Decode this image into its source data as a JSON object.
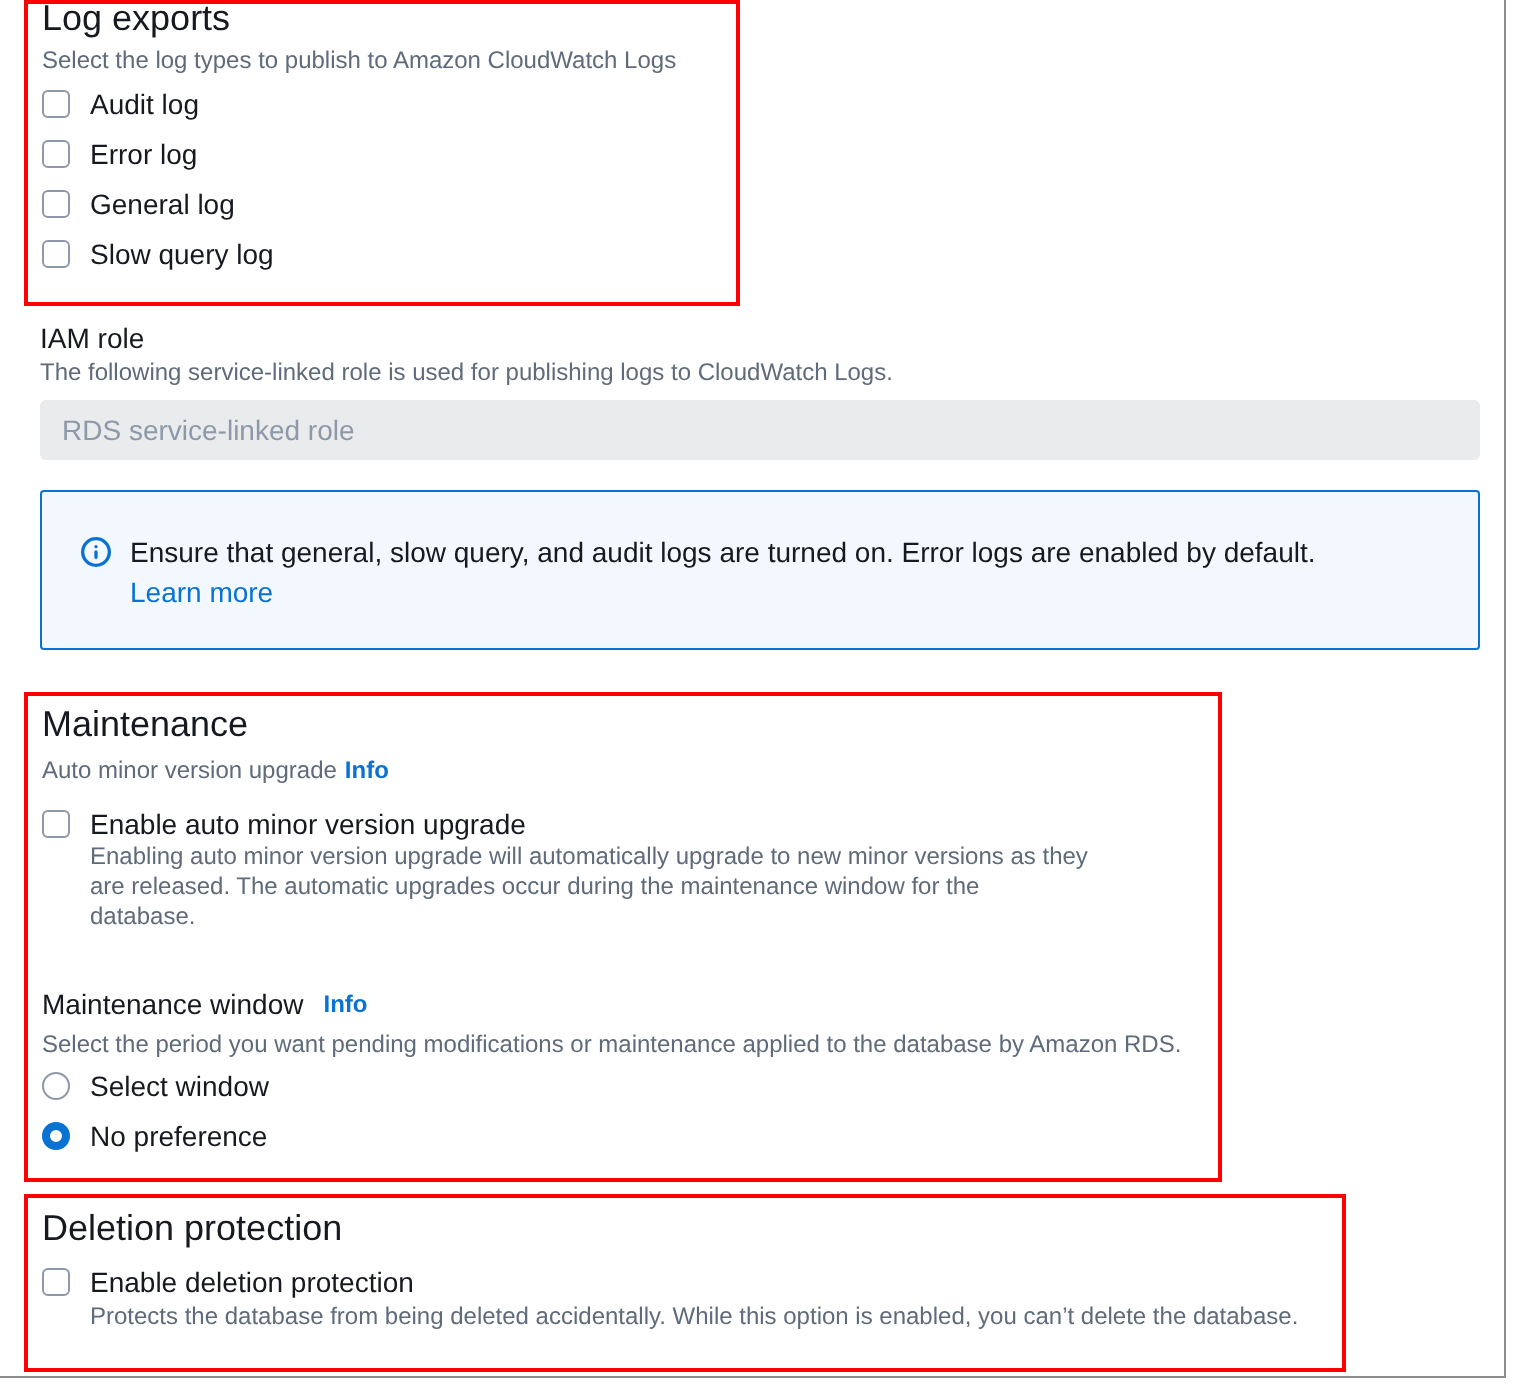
{
  "log_exports": {
    "title": "Log exports",
    "highlighted": true,
    "description": "Select the log types to publish to Amazon CloudWatch Logs",
    "options": [
      {
        "label": "Audit log",
        "checked": false
      },
      {
        "label": "Error log",
        "checked": false
      },
      {
        "label": "General log",
        "checked": false
      },
      {
        "label": "Slow query log",
        "checked": false
      }
    ]
  },
  "iam_role": {
    "label": "IAM role",
    "description": "The following service-linked role is used for publishing logs to CloudWatch Logs.",
    "value": "RDS service-linked role",
    "disabled": true
  },
  "alert": {
    "text": "Ensure that general, slow query, and audit logs are turned on. Error logs are enabled by default.",
    "link": "Learn more"
  },
  "maintenance": {
    "title": "Maintenance",
    "highlighted": true,
    "subtitle": "Auto minor version upgrade",
    "subtitle_info": "Info",
    "checkbox": {
      "label": "Enable auto minor version upgrade",
      "description": "Enabling auto minor version upgrade will automatically upgrade to new minor versions as they are released. The automatic upgrades occur during the maintenance window for the database.",
      "checked": false
    },
    "window": {
      "label": "Maintenance window",
      "info": "Info",
      "description": "Select the period you want pending modifications or maintenance applied to the database by Amazon RDS.",
      "options": [
        {
          "label": "Select window",
          "selected": false
        },
        {
          "label": "No preference",
          "selected": true
        }
      ]
    }
  },
  "deletion_protection": {
    "title": "Deletion protection",
    "highlighted": true,
    "checkbox": {
      "label": "Enable deletion protection",
      "description": "Protects the database from being deleted accidentally. While this option is enabled, you can’t delete the database.",
      "checked": false
    }
  }
}
